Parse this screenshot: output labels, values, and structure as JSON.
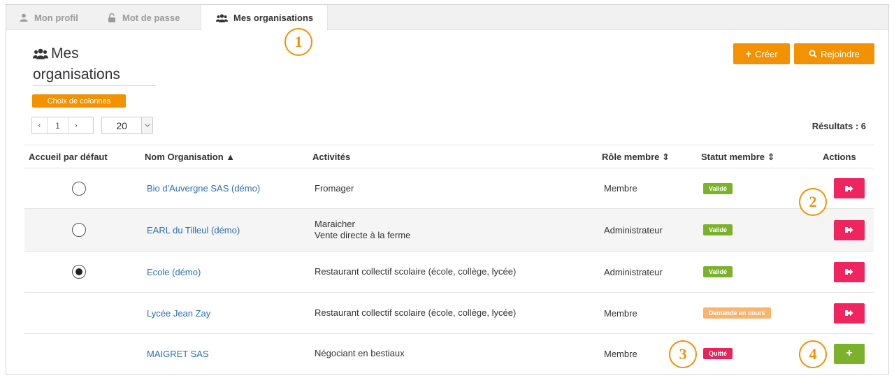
{
  "tabs": [
    {
      "label": "Mon profil",
      "icon": "user-icon"
    },
    {
      "label": "Mot de passe",
      "icon": "unlock-icon"
    },
    {
      "label": "Mes organisations",
      "icon": "users-icon"
    }
  ],
  "page": {
    "title_line1": "Mes",
    "title_line2": "organisations",
    "create_label": "Créer",
    "join_label": "Rejoindre",
    "columns_label": "Choix de colonnes",
    "results_label": "Résultats : 6"
  },
  "pagination": {
    "prev": "‹",
    "current": "1",
    "next": "›",
    "page_size": "20"
  },
  "table": {
    "headers": {
      "default": "Accueil par défaut",
      "name": "Nom Organisation ▲",
      "activities": "Activités",
      "role": "Rôle membre ⇕",
      "status": "Statut membre ⇕",
      "actions": "Actions"
    },
    "rows": [
      {
        "radio": "unchecked",
        "name": "Bio d'Auvergne SAS (démo)",
        "activity1": "Fromager",
        "activity2": "",
        "role": "Membre",
        "status": "Validé",
        "action": "leave"
      },
      {
        "radio": "unchecked",
        "name": "EARL du Tilleul (démo)",
        "activity1": "Maraicher",
        "activity2": "Vente directe à la ferme",
        "role": "Administrateur",
        "status": "Validé",
        "action": "leave"
      },
      {
        "radio": "checked",
        "name": "Ecole (démo)",
        "activity1": "Restaurant collectif scolaire (école, collège, lycée)",
        "activity2": "",
        "role": "Administrateur",
        "status": "Validé",
        "action": "leave"
      },
      {
        "radio": "none",
        "name": "Lycée Jean Zay",
        "activity1": "Restaurant collectif scolaire (école, collège, lycée)",
        "activity2": "",
        "role": "Membre",
        "status": "Demande en cours",
        "action": "leave"
      },
      {
        "radio": "none",
        "name": "MAIGRET SAS",
        "activity1": "Négociant en bestiaux",
        "activity2": "",
        "role": "Membre",
        "status": "Quitté",
        "action": "join"
      }
    ]
  },
  "callouts": [
    "1",
    "2",
    "3",
    "4"
  ],
  "colors": {
    "accent_orange": "#f39200",
    "validated_green": "#7cb22b",
    "pending_orange": "#f9b56f",
    "left_pink": "#e9245a",
    "leave_button": "#f0245e",
    "link_blue": "#2a6fb5"
  }
}
